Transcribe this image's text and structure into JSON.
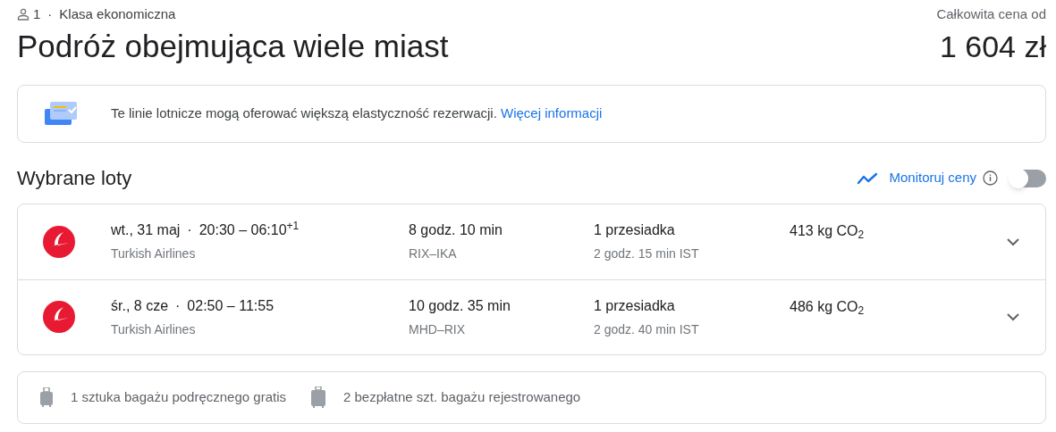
{
  "header": {
    "passengers": "1",
    "separator": "·",
    "cabin_class": "Klasa ekonomiczna",
    "title": "Podróż obejmująca wiele miast",
    "price_label": "Całkowita cena od",
    "price": "1 604 zł"
  },
  "notice": {
    "text": "Te linie lotnicze mogą oferować większą elastyczność rezerwacji.",
    "link": "Więcej informacji"
  },
  "section": {
    "title": "Wybrane loty",
    "track_label": "Monitoruj ceny",
    "track_on": false
  },
  "flights": [
    {
      "date": "wt., 31 maj",
      "separator": "·",
      "times": "20:30 – 06:10$^{+1}$",
      "airline": "Turkish Airlines",
      "duration": "8 godz. 10 min",
      "route": "RIX–IKA",
      "stops": "1 przesiadka",
      "layover": "2 godz. 15 min IST",
      "emissions": "413 kg CO$_{2}$",
      "expanded": false
    },
    {
      "date": "śr., 8 cze",
      "separator": "·",
      "times": "02:50 – 11:55",
      "airline": "Turkish Airlines",
      "duration": "10 godz. 35 min",
      "route": "MHD–RIX",
      "stops": "1 przesiadka",
      "layover": "2 godz. 40 min IST",
      "emissions": "486 kg CO$_{2}$",
      "expanded": false
    }
  ],
  "baggage": [
    {
      "kind": "carry_on",
      "text": "1 sztuka bagażu podręcznego gratis"
    },
    {
      "kind": "checked",
      "text": "2 bezpłatne szt. bagażu rejestrowanego"
    }
  ]
}
